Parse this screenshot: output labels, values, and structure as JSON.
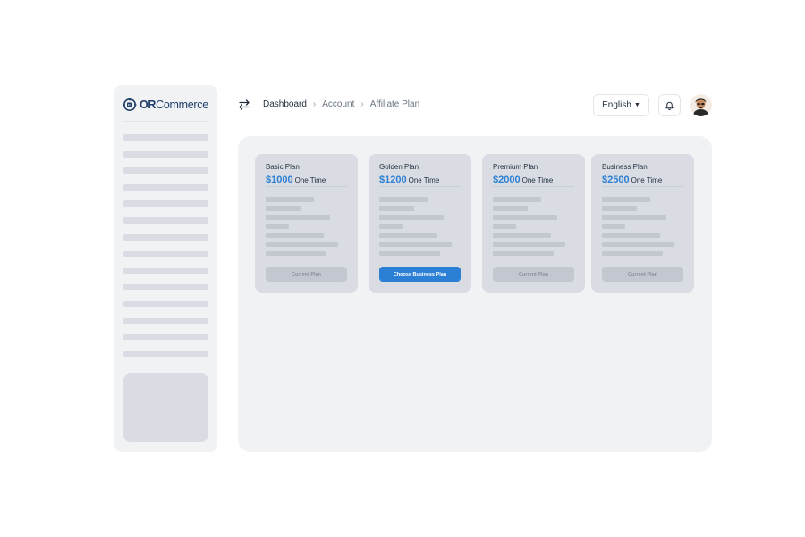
{
  "brand": {
    "logo_bold": "OR",
    "logo_rest": "Commerce",
    "logo_icon": "robot-logo-icon"
  },
  "sidebar": {
    "item_count": 14
  },
  "header": {
    "swap_icon": "swap-arrows-icon",
    "breadcrumb": [
      "Dashboard",
      "Account",
      "Affiliate Plan"
    ],
    "language": "English",
    "bell_icon": "bell-icon"
  },
  "plans": [
    {
      "name": "Basic Plan",
      "price": "$1000",
      "term": "One Time",
      "button": "Current Plan",
      "primary": false
    },
    {
      "name": "Golden Plan",
      "price": "$1200",
      "term": "One Time",
      "button": "Choose Business Plan",
      "primary": true
    },
    {
      "name": "Premium Plan",
      "price": "$2000",
      "term": "One Time",
      "button": "Current Plan",
      "primary": false
    },
    {
      "name": "Business Plan",
      "price": "$2500",
      "term": "One Time",
      "button": "Current Plan",
      "primary": false
    }
  ],
  "colors": {
    "accent": "#2b7fd4",
    "brand": "#1f3c68"
  }
}
